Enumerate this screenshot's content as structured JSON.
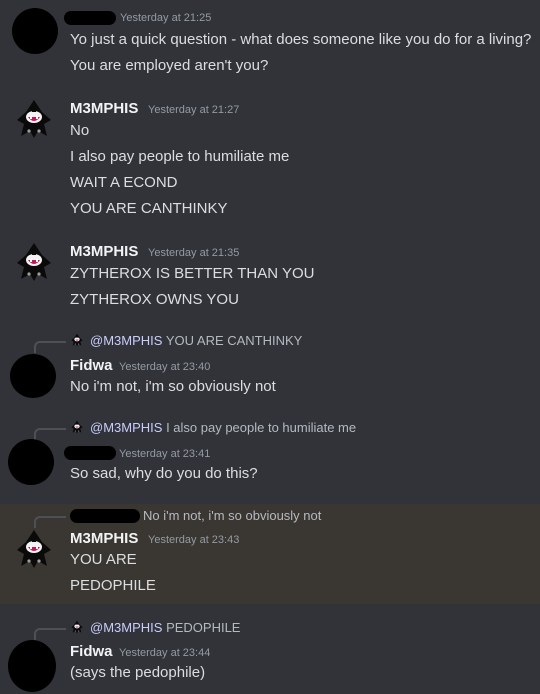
{
  "messages": [
    {
      "timestamp": "Yesterday at 21:25",
      "lines": [
        "Yo just a quick question - what does someone like you do for a living?",
        "You are employed aren't you?"
      ]
    },
    {
      "author": "M3MPHIS",
      "timestamp": "Yesterday at 21:27",
      "lines": [
        "No",
        "I also pay people to humiliate me",
        "WAIT A ECOND",
        "YOU ARE CANTHINKY"
      ]
    },
    {
      "author": "M3MPHIS",
      "timestamp": "Yesterday at 21:35",
      "lines": [
        "ZYTHEROX IS BETTER THAN YOU",
        "ZYTHEROX OWNS YOU"
      ]
    },
    {
      "reply": {
        "mention": "@M3MPHIS",
        "text": "YOU ARE CANTHINKY"
      },
      "author": "Fidwa",
      "timestamp": "Yesterday at 23:40",
      "lines": [
        "No i'm not, i'm so obviously not"
      ]
    },
    {
      "reply": {
        "mention": "@M3MPHIS",
        "text": "I also pay people to humiliate me"
      },
      "timestamp": "Yesterday at 23:41",
      "lines": [
        "So sad, why do you do this?"
      ]
    },
    {
      "reply": {
        "text": "No i'm not, i'm so obviously not"
      },
      "author": "M3MPHIS",
      "timestamp": "Yesterday at 23:43",
      "lines": [
        "YOU ARE",
        "PEDOPHILE"
      ]
    },
    {
      "reply": {
        "mention": "@M3MPHIS",
        "text": "PEDOPHILE"
      },
      "author": "Fidwa",
      "timestamp": "Yesterday at 23:44",
      "lines": [
        "(says the pedophile)"
      ]
    }
  ],
  "colors": {
    "background": "#313338",
    "highlight": "#3a3631",
    "username": "#f2f3f5",
    "timestamp": "#949ba4",
    "mention": "#c9cdfb"
  }
}
